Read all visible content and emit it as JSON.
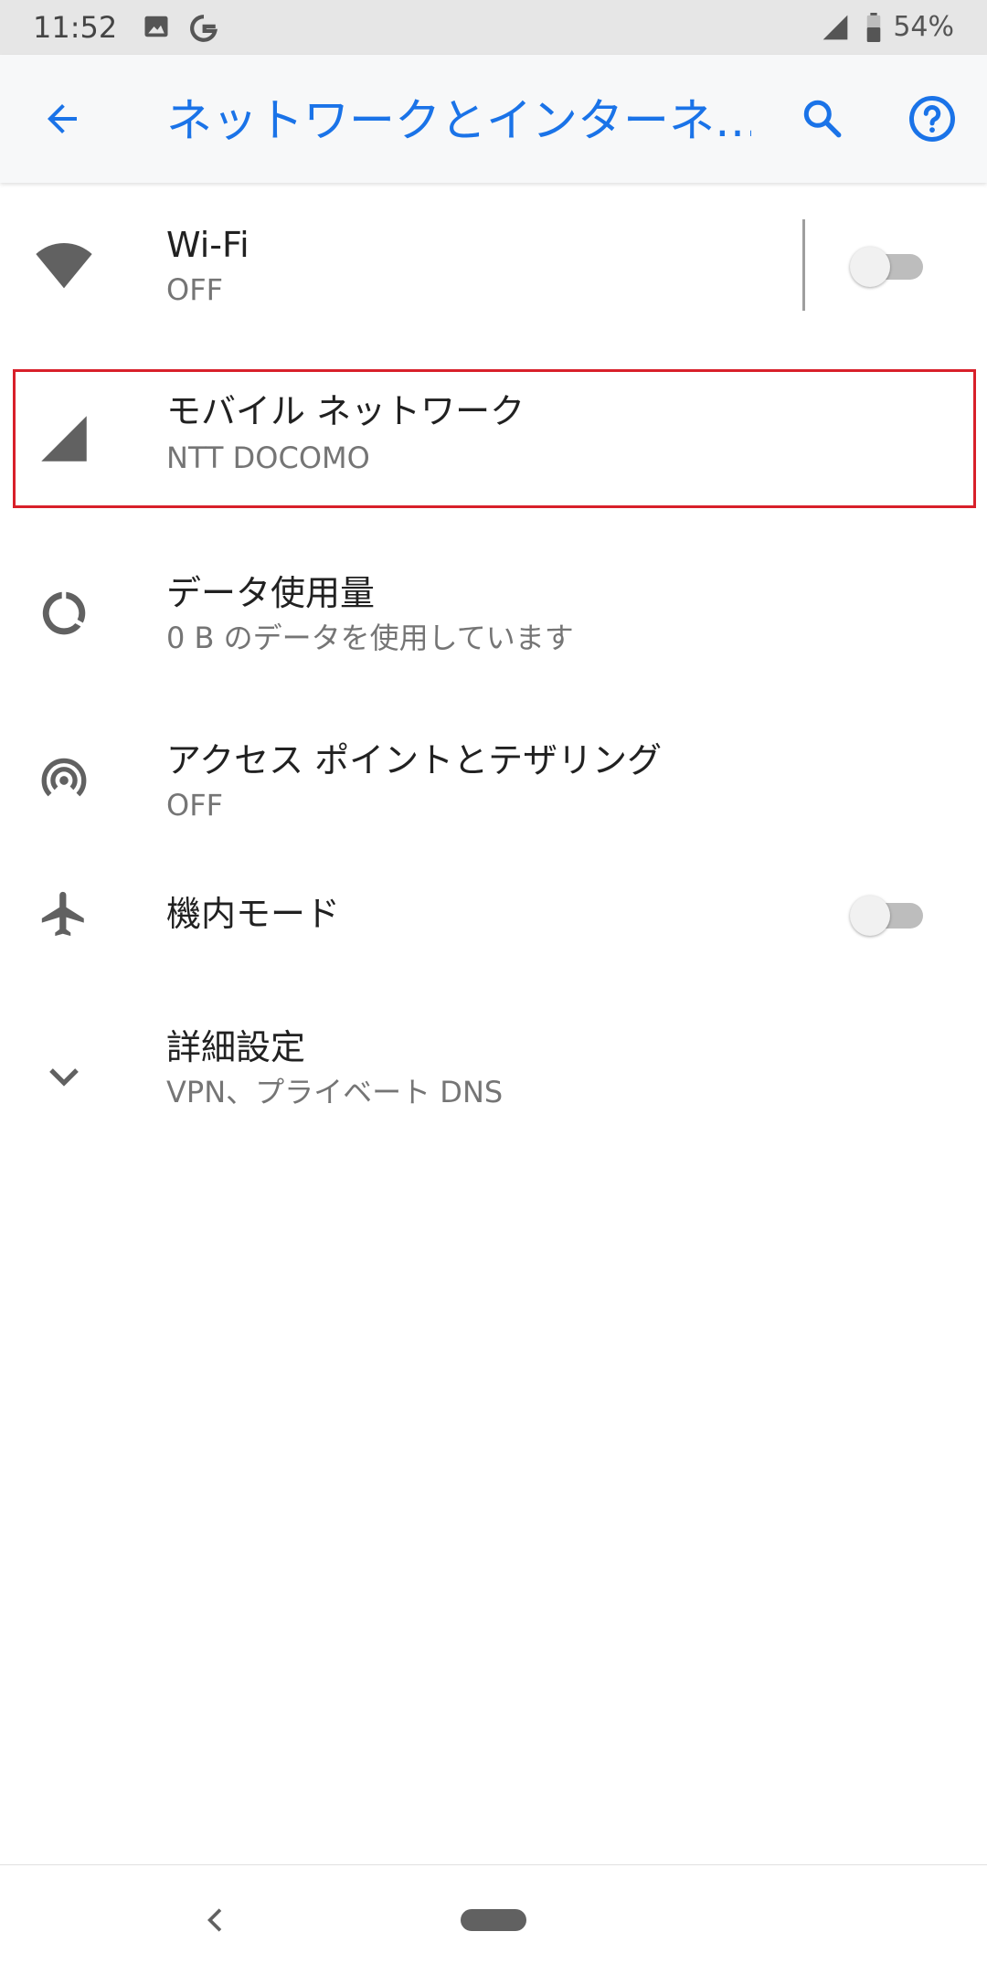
{
  "status_bar": {
    "time": "11:52",
    "battery": "54%",
    "icons": [
      "image-icon",
      "google-g-icon",
      "signal-icon",
      "battery-icon"
    ]
  },
  "app_bar": {
    "title": "ネットワークとインターネ…",
    "icons": [
      "back-arrow-icon",
      "search-icon",
      "help-icon"
    ]
  },
  "items": [
    {
      "icon": "wifi-icon",
      "title": "Wi-Fi",
      "subtitle": "OFF",
      "toggle": false
    },
    {
      "icon": "cellular-signal-icon",
      "title": "モバイル ネットワーク",
      "subtitle": "NTT DOCOMO"
    },
    {
      "icon": "data-usage-icon",
      "title": "データ使用量",
      "subtitle": "0 B のデータを使用しています"
    },
    {
      "icon": "hotspot-icon",
      "title": "アクセス ポイントとテザリング",
      "subtitle": "OFF"
    },
    {
      "icon": "airplane-icon",
      "title": "機内モード",
      "toggle": false
    },
    {
      "icon": "chevron-down-icon",
      "title": "詳細設定",
      "subtitle": "VPN、プライベート DNS"
    }
  ],
  "colors": {
    "accent": "#1a73e8",
    "highlight": "#d8202a",
    "icon": "#757575"
  },
  "nav_bar": {
    "icons": [
      "nav-back-icon",
      "nav-home-pill"
    ]
  }
}
